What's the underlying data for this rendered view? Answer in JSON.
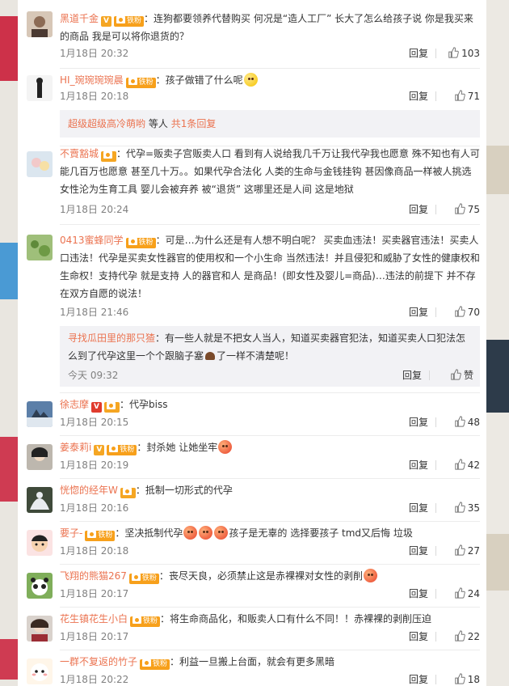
{
  "colors": {
    "username": "#eb7350",
    "time": "#808080",
    "text": "#333333",
    "subbox": "#f2f2f5",
    "fan_badge": "#f7a01b",
    "v_badge": "#f5a623"
  },
  "icons": {
    "like": "thumbs-up-icon",
    "v": "v-badge-icon",
    "fan": "fan-badge-icon"
  },
  "comments": [
    {
      "username": "黑道千金",
      "vip": "V",
      "fan": "铁粉",
      "text": "连狗都要领养代替购买 何况是“造人工厂” 长大了怎么给孩子说 你是我买来的商品 我是可以将你退货的？",
      "time": "1月18日 20:32",
      "reply": "回复",
      "likes": "103"
    },
    {
      "username": "HI_琬琬琬琬晨",
      "fan": "铁粉",
      "text": "孩子做错了什么呢",
      "time": "1月18日 20:18",
      "reply": "回复",
      "likes": "71"
    },
    {
      "username": "不賣豁城",
      "fan": "",
      "text": "代孕=贩卖子宫贩卖人口 看到有人说给我几千万让我代孕我也愿意 殊不知也有人可能几百万也愿意 甚至几十万。。如果代孕合法化 人类的生命与金钱挂钩 甚因像商品一样被人挑选 女性沦为生育工具 婴儿会被弃养 被“退货” 这哪里还是人间 这是地狱",
      "time": "1月18日 20:24",
      "reply": "回复",
      "likes": "75"
    },
    {
      "username": "0413蜜蜂同学",
      "fan": "铁粉",
      "text": "可是…为什么还是有人想不明白呢？ 买卖血违法！买卖器官违法！买卖人口违法！代孕是买卖女性器官的使用权和一个小生命 当然违法！并且侵犯和威胁了女性的健康权和生命权！支持代孕 就是支持 人的器官和人 是商品！(即女性及婴儿=商品)…违法的前提下 并不存在双方自愿的说法！",
      "time": "1月18日 21:46",
      "reply": "回复",
      "likes": "70"
    },
    {
      "username": "徐志摩",
      "vip": "V",
      "fan": "",
      "text": "代孕biss",
      "time": "1月18日 20:15",
      "reply": "回复",
      "likes": "48"
    },
    {
      "username": "姜泰莉i",
      "vip": "V",
      "fan": "铁粉",
      "text": "封杀她 让她坐牢",
      "time": "1月18日 20:19",
      "reply": "回复",
      "likes": "42"
    },
    {
      "username": "恍惚的经年W",
      "fan": "",
      "text": "抵制一切形式的代孕",
      "time": "1月18日 20:16",
      "reply": "回复",
      "likes": "35"
    },
    {
      "username": "要子-",
      "fan": "铁粉",
      "text_a": "坚决抵制代孕",
      "text_b": "孩子是无辜的 选择要孩子 tmd又后悔 垃圾",
      "time": "1月18日 20:18",
      "reply": "回复",
      "likes": "27"
    },
    {
      "username": "飞翔的熊猫267",
      "fan": "铁粉",
      "text": "丧尽天良，必须禁止这是赤裸裸对女性的剥削",
      "time": "1月18日 20:17",
      "reply": "回复",
      "likes": "24"
    },
    {
      "username": "花生镇花生小白",
      "fan": "铁粉",
      "text": "将生命商品化，和贩卖人口有什么不同！！赤裸裸的剥削压迫",
      "time": "1月18日 20:17",
      "reply": "回复",
      "likes": "22"
    },
    {
      "username": "一群不复返的竹子",
      "fan": "铁粉",
      "text": "利益一旦搬上台面，就会有更多黑暗",
      "time": "1月18日 20:22",
      "reply": "回复",
      "likes": "18"
    }
  ],
  "sub_replies": {
    "more": {
      "user": "超级超级高冷萌哟",
      "text": "等人",
      "count": "共1条回复"
    },
    "reply1": {
      "username": "寻找瓜田里的那只猹",
      "text_a": "有一些人就是不把女人当人，知道买卖器官犯法，知道买卖人口犯法怎么到了代孕这里一个个跟脑子塞",
      "text_b": "了一样不清楚呢！",
      "time": "今天 09:32",
      "reply": "回复",
      "likes": "赞"
    }
  }
}
